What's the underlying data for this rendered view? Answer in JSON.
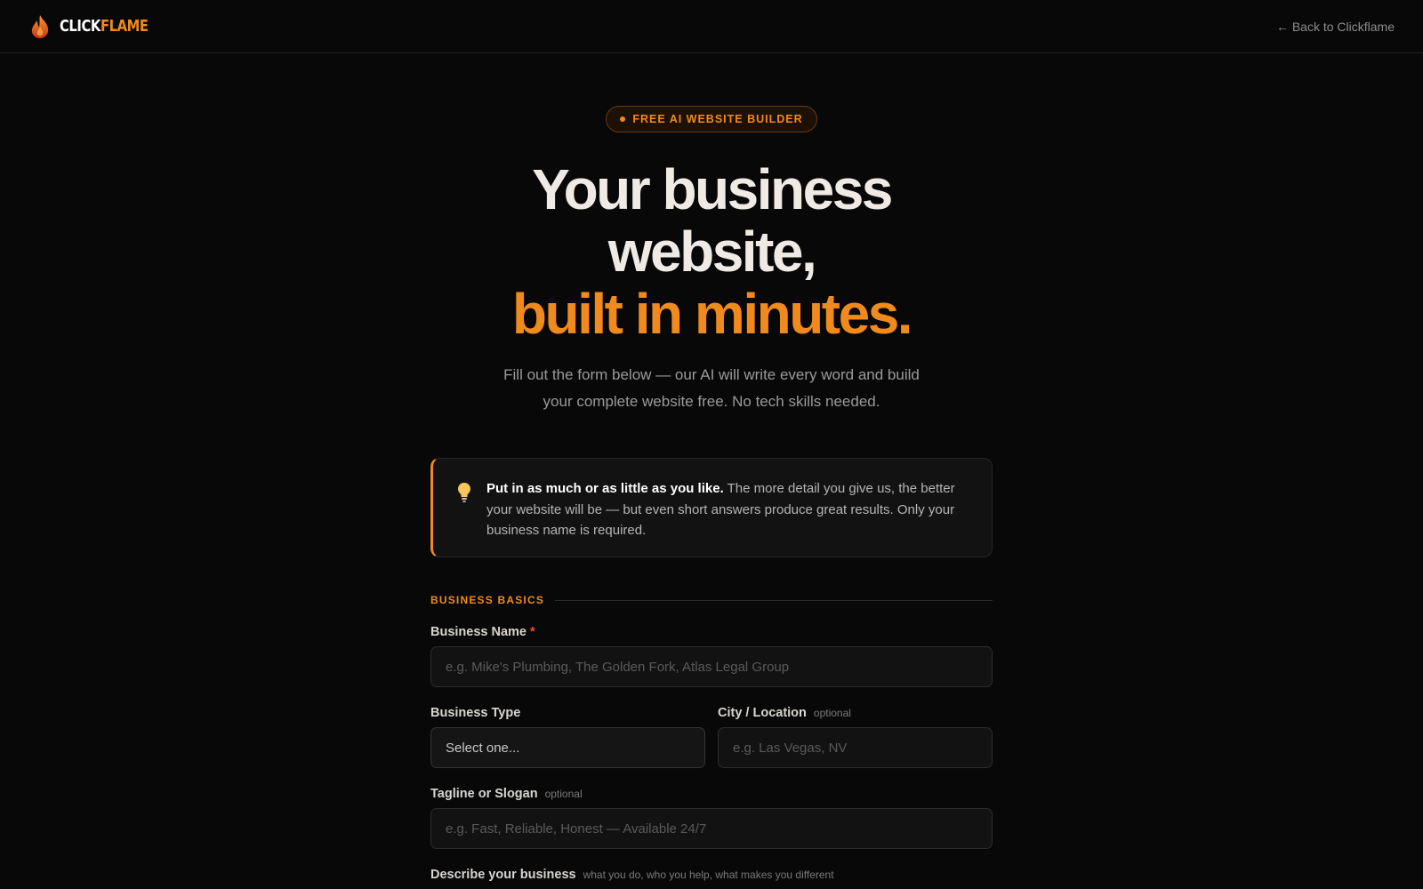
{
  "header": {
    "brand_part1": "CLICK",
    "brand_part2": "FLAME",
    "logo_icon": "flame-icon",
    "back_link": "← Back to Clickflame"
  },
  "hero": {
    "badge": "FREE AI WEBSITE BUILDER",
    "headline_line1": "Your business",
    "headline_line2": "website,",
    "headline_line3": "built in minutes.",
    "subtitle_line1": "Fill out the form below — our AI will write every word and build",
    "subtitle_line2": "your complete website free. No tech skills needed."
  },
  "tip": {
    "icon": "lightbulb-icon",
    "bold": "Put in as much or as little as you like.",
    "text": " The more detail you give us, the better your website will be — but even short answers produce great results. Only your business name is required."
  },
  "form": {
    "section_title": "BUSINESS BASICS",
    "business_name": {
      "label": "Business Name",
      "required_mark": "*",
      "placeholder": "e.g. Mike's Plumbing, The Golden Fork, Atlas Legal Group"
    },
    "business_type": {
      "label": "Business Type",
      "selected": "Select one..."
    },
    "city": {
      "label": "City / Location",
      "hint": "optional",
      "placeholder": "e.g. Las Vegas, NV"
    },
    "tagline": {
      "label": "Tagline or Slogan",
      "hint": "optional",
      "placeholder": "e.g. Fast, Reliable, Honest — Available 24/7"
    },
    "describe": {
      "label": "Describe your business",
      "hint": "what you do, who you help, what makes you different"
    }
  },
  "colors": {
    "accent": "#f08a1c",
    "background": "#080808",
    "required": "#f0502a"
  }
}
